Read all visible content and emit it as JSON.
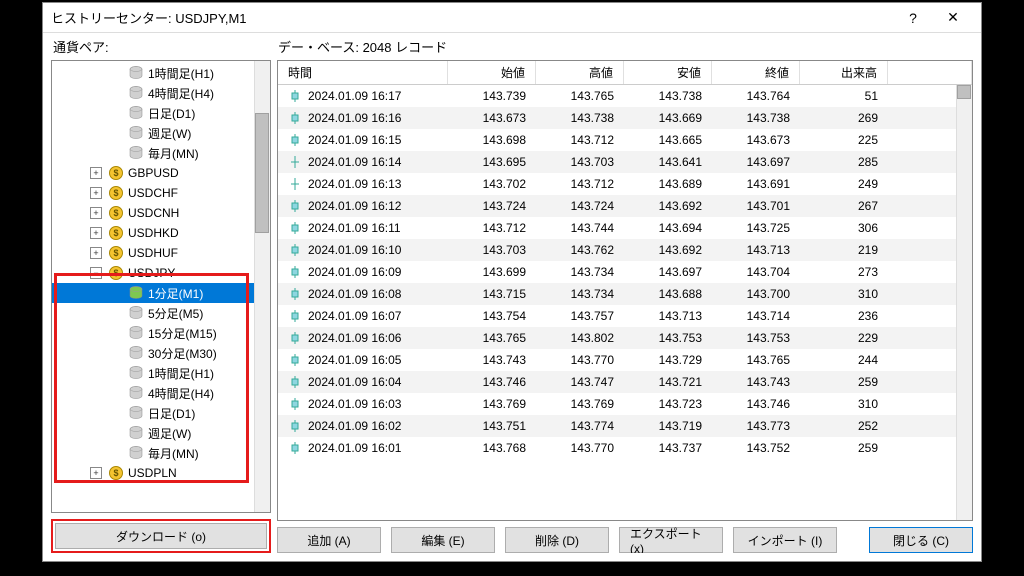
{
  "window": {
    "title": "ヒストリーセンター: USDJPY,M1",
    "minimize": "?",
    "close": "✕"
  },
  "labels": {
    "pair": "通貨ペア:",
    "database": "デー・ベース: 2048 レコード"
  },
  "tree": {
    "timeframes_upper": [
      "1時間足(H1)",
      "4時間足(H4)",
      "日足(D1)",
      "週足(W)",
      "毎月(MN)"
    ],
    "symbols": [
      "GBPUSD",
      "USDCHF",
      "USDCNH",
      "USDHKD",
      "USDHUF"
    ],
    "active_symbol": "USDJPY",
    "active_tf": "1分足(M1)",
    "timeframes": [
      "1分足(M1)",
      "5分足(M5)",
      "15分足(M15)",
      "30分足(M30)",
      "1時間足(H1)",
      "4時間足(H4)",
      "日足(D1)",
      "週足(W)",
      "毎月(MN)"
    ],
    "next_symbol": "USDPLN"
  },
  "table": {
    "headers": {
      "time": "時間",
      "open": "始値",
      "high": "高値",
      "low": "安値",
      "close": "終値",
      "volume": "出来高"
    },
    "rows": [
      {
        "time": "2024.01.09 16:17",
        "open": "143.739",
        "high": "143.765",
        "low": "143.738",
        "close": "143.764",
        "vol": "51"
      },
      {
        "time": "2024.01.09 16:16",
        "open": "143.673",
        "high": "143.738",
        "low": "143.669",
        "close": "143.738",
        "vol": "269"
      },
      {
        "time": "2024.01.09 16:15",
        "open": "143.698",
        "high": "143.712",
        "low": "143.665",
        "close": "143.673",
        "vol": "225"
      },
      {
        "time": "2024.01.09 16:14",
        "open": "143.695",
        "high": "143.703",
        "low": "143.641",
        "close": "143.697",
        "vol": "285"
      },
      {
        "time": "2024.01.09 16:13",
        "open": "143.702",
        "high": "143.712",
        "low": "143.689",
        "close": "143.691",
        "vol": "249"
      },
      {
        "time": "2024.01.09 16:12",
        "open": "143.724",
        "high": "143.724",
        "low": "143.692",
        "close": "143.701",
        "vol": "267"
      },
      {
        "time": "2024.01.09 16:11",
        "open": "143.712",
        "high": "143.744",
        "low": "143.694",
        "close": "143.725",
        "vol": "306"
      },
      {
        "time": "2024.01.09 16:10",
        "open": "143.703",
        "high": "143.762",
        "low": "143.692",
        "close": "143.713",
        "vol": "219"
      },
      {
        "time": "2024.01.09 16:09",
        "open": "143.699",
        "high": "143.734",
        "low": "143.697",
        "close": "143.704",
        "vol": "273"
      },
      {
        "time": "2024.01.09 16:08",
        "open": "143.715",
        "high": "143.734",
        "low": "143.688",
        "close": "143.700",
        "vol": "310"
      },
      {
        "time": "2024.01.09 16:07",
        "open": "143.754",
        "high": "143.757",
        "low": "143.713",
        "close": "143.714",
        "vol": "236"
      },
      {
        "time": "2024.01.09 16:06",
        "open": "143.765",
        "high": "143.802",
        "low": "143.753",
        "close": "143.753",
        "vol": "229"
      },
      {
        "time": "2024.01.09 16:05",
        "open": "143.743",
        "high": "143.770",
        "low": "143.729",
        "close": "143.765",
        "vol": "244"
      },
      {
        "time": "2024.01.09 16:04",
        "open": "143.746",
        "high": "143.747",
        "low": "143.721",
        "close": "143.743",
        "vol": "259"
      },
      {
        "time": "2024.01.09 16:03",
        "open": "143.769",
        "high": "143.769",
        "low": "143.723",
        "close": "143.746",
        "vol": "310"
      },
      {
        "time": "2024.01.09 16:02",
        "open": "143.751",
        "high": "143.774",
        "low": "143.719",
        "close": "143.773",
        "vol": "252"
      },
      {
        "time": "2024.01.09 16:01",
        "open": "143.768",
        "high": "143.770",
        "low": "143.737",
        "close": "143.752",
        "vol": "259"
      }
    ]
  },
  "buttons": {
    "download": "ダウンロード (o)",
    "add": "追加 (A)",
    "edit": "編集 (E)",
    "delete": "削除 (D)",
    "export": "エクスポート (x)",
    "import": "インポート (I)",
    "close": "閉じる (C)"
  }
}
